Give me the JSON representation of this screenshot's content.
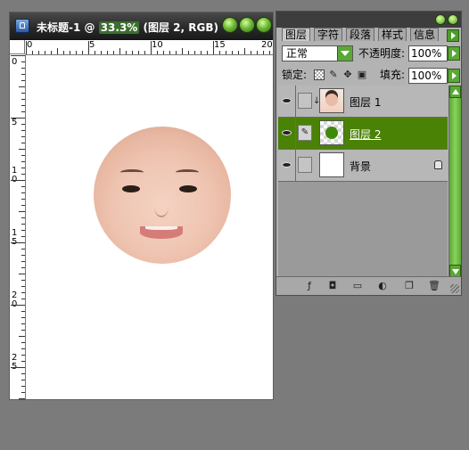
{
  "document": {
    "title_prefix": "未标题-1 @ ",
    "zoom": "33.3%",
    "title_suffix": " (图层 2, RGB)",
    "ruler_top_labels": [
      "0",
      "5",
      "10",
      "15",
      "20"
    ],
    "ruler_left_labels": [
      "0",
      "5",
      "1\n0",
      "1\n5",
      "2\n0",
      "2\n5"
    ]
  },
  "layers_panel": {
    "tabs": [
      "图层",
      "字符",
      "段落",
      "样式",
      "信息"
    ],
    "blend_mode": "正常",
    "opacity_label": "不透明度:",
    "opacity_value": "100%",
    "lock_label": "锁定:",
    "fill_label": "填充:",
    "fill_value": "100%",
    "layers": [
      {
        "name": "图层 1",
        "thumb": "portrait"
      },
      {
        "name": "图层 2",
        "thumb": "green-circle"
      },
      {
        "name": "背景",
        "thumb": "white"
      }
    ],
    "selected_layer": "图层 2",
    "colors": {
      "accent": "#4a8206",
      "button": "#5aa835"
    }
  }
}
